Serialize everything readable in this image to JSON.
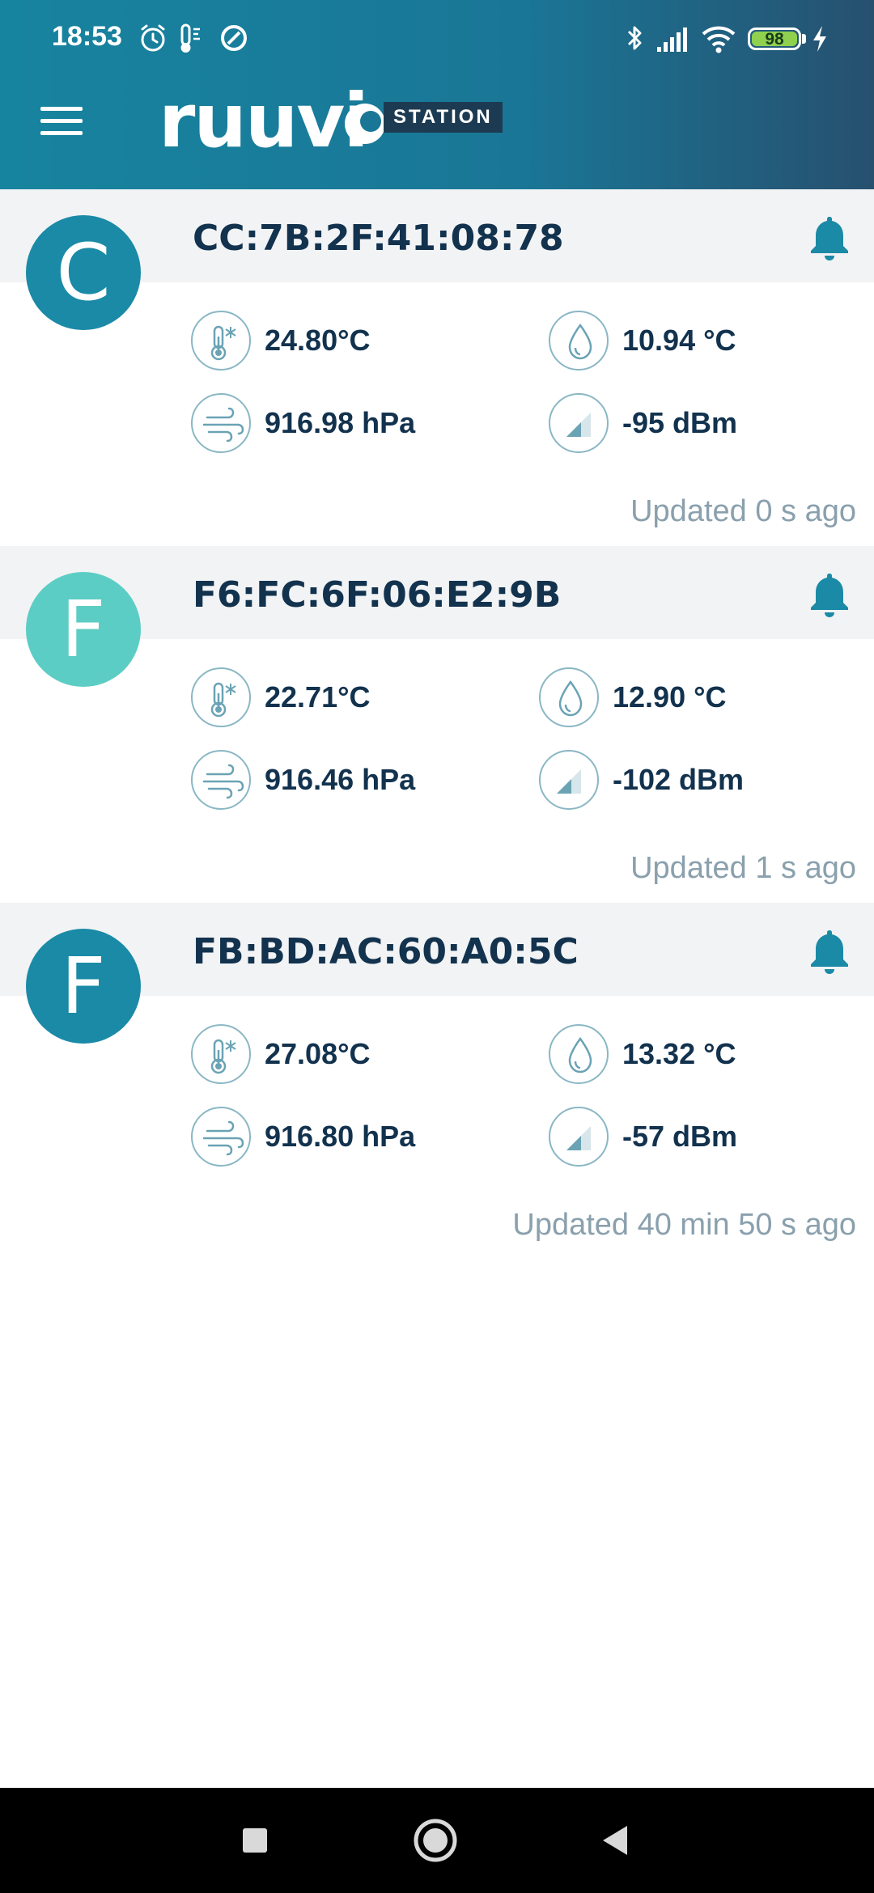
{
  "status_bar": {
    "time": "18:53",
    "battery_level": "98",
    "icons": [
      "alarm-icon",
      "thermometer-icon",
      "sync-icon",
      "bluetooth-icon",
      "signal-icon",
      "wifi-icon",
      "battery-icon",
      "charging-icon"
    ]
  },
  "header": {
    "logo_text": "ruuvi",
    "logo_badge": "STATION",
    "menu_icon": "hamburger-menu-icon"
  },
  "sensors": [
    {
      "avatar_letter": "C",
      "avatar_color": "#1a8aa6",
      "name": "CC:7B:2F:41:08:78",
      "temperature": "24.80°C",
      "humidity": "10.94 °C",
      "pressure": "916.98 hPa",
      "rssi": "-95 dBm",
      "updated": "Updated 0 s ago"
    },
    {
      "avatar_letter": "F",
      "avatar_color": "#5ccdc4",
      "name": "F6:FC:6F:06:E2:9B",
      "temperature": "22.71°C",
      "humidity": "12.90 °C",
      "pressure": "916.46 hPa",
      "rssi": "-102 dBm",
      "updated": "Updated 1 s ago"
    },
    {
      "avatar_letter": "F",
      "avatar_color": "#1a8aa6",
      "name": "FB:BD:AC:60:A0:5C",
      "temperature": "27.08°C",
      "humidity": "13.32 °C",
      "pressure": "916.80 hPa",
      "rssi": "-57 dBm",
      "updated": "Updated 40 min 50 s ago"
    }
  ],
  "colors": {
    "header_start": "#17849f",
    "header_end": "#27506f",
    "accent": "#1a8aa6",
    "text_dark": "#12324e",
    "text_muted": "#8aa0ad",
    "card_header_bg": "#f2f3f5"
  },
  "nav_bar": {
    "buttons": [
      "recents-square-icon",
      "home-circle-icon",
      "back-triangle-icon"
    ]
  }
}
